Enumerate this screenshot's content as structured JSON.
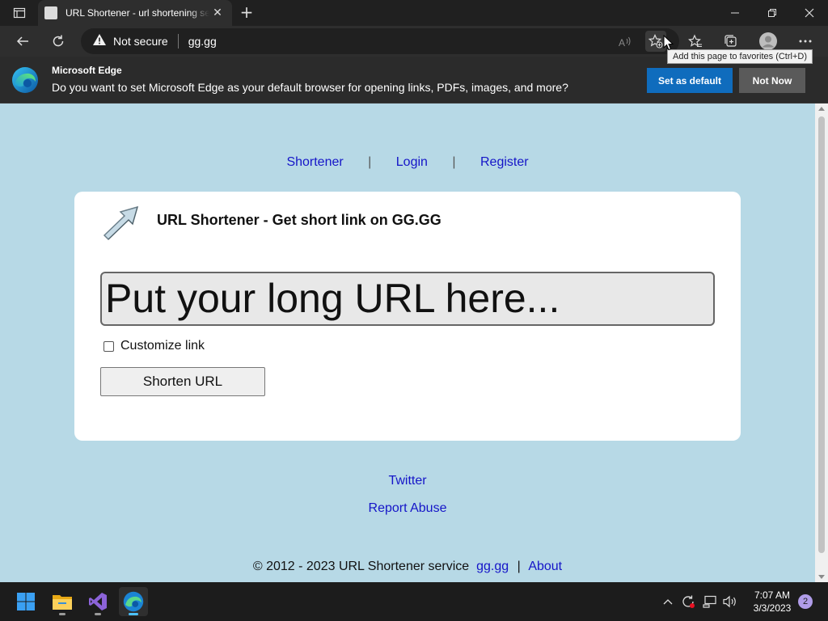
{
  "browser": {
    "tab": {
      "title": "URL Shortener - url shortening service"
    },
    "address": {
      "security": "Not secure",
      "url": "gg.gg"
    },
    "tooltip": "Add this page to favorites (Ctrl+D)"
  },
  "infobar": {
    "title": "Microsoft Edge",
    "message": "Do you want to set Microsoft Edge as your default browser for opening links, PDFs, images, and more?",
    "set_default_label": "Set as default",
    "not_now_label": "Not Now"
  },
  "page": {
    "nav": [
      "Shortener",
      "Login",
      "Register"
    ],
    "nav_sep": "|",
    "card": {
      "title": "URL Shortener - Get short link on GG.GG",
      "url_placeholder": "Put your long URL here...",
      "customize_label": "Customize link",
      "shorten_label": "Shorten URL"
    },
    "footer": {
      "twitter": "Twitter",
      "report": "Report Abuse",
      "copyright": "© 2012 - 2023 URL Shortener service",
      "site_link": "gg.gg",
      "sep": "|",
      "about": "About"
    },
    "colors": {
      "background": "#b7d9e6",
      "link": "#1515c8",
      "card": "#ffffff"
    }
  },
  "taskbar": {
    "time": "7:07 AM",
    "date": "3/3/2023",
    "notifications": "2"
  }
}
